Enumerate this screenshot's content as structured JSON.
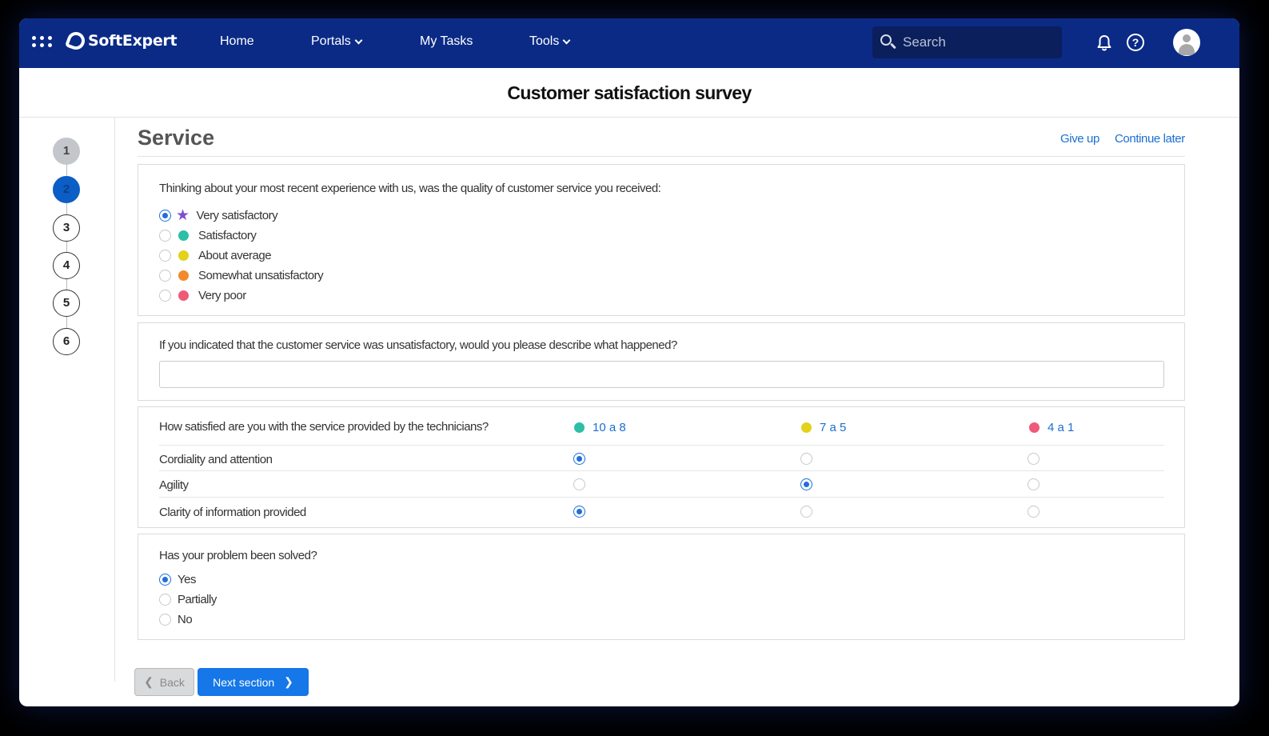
{
  "nav": {
    "brand": "SoftExpert",
    "items": [
      {
        "label": "Home"
      },
      {
        "label": "Portals"
      },
      {
        "label": "My Tasks"
      },
      {
        "label": "Tools"
      }
    ],
    "search_placeholder": "Search"
  },
  "page": {
    "title": "Customer satisfaction survey",
    "section_title": "Service",
    "give_up": "Give up",
    "continue_later": "Continue later"
  },
  "steps": [
    {
      "label": "1",
      "state": "done"
    },
    {
      "label": "2",
      "state": "active"
    },
    {
      "label": "3",
      "state": "pending"
    },
    {
      "label": "4",
      "state": "pending"
    },
    {
      "label": "5",
      "state": "pending"
    },
    {
      "label": "6",
      "state": "pending"
    }
  ],
  "q1": {
    "text": "Thinking about your most recent experience with us, was the quality of customer service you received:",
    "options": [
      {
        "label": "Very satisfactory",
        "marker": "star-icon",
        "color": "#7b4fd3",
        "selected": true
      },
      {
        "label": "Satisfactory",
        "marker": "dot",
        "color": "#2dbfa6",
        "selected": false
      },
      {
        "label": "About average",
        "marker": "dot",
        "color": "#e3d11a",
        "selected": false
      },
      {
        "label": "Somewhat unsatisfactory",
        "marker": "dot",
        "color": "#f28a2a",
        "selected": false
      },
      {
        "label": "Very poor",
        "marker": "dot",
        "color": "#ee5a78",
        "selected": false
      }
    ]
  },
  "q2": {
    "text": "If you indicated that the customer service was unsatisfactory, would you please describe what happened?",
    "value": ""
  },
  "q3": {
    "text": "How satisfied are you with the service provided by the technicians?",
    "columns": [
      {
        "label": "10 a 8",
        "color": "#2dbfa6"
      },
      {
        "label": "7 a 5",
        "color": "#e3d11a"
      },
      {
        "label": "4 a 1",
        "color": "#ee5a78"
      }
    ],
    "rows": [
      {
        "label": "Cordiality and attention",
        "selected": 0
      },
      {
        "label": "Agility",
        "selected": 1
      },
      {
        "label": "Clarity of information provided",
        "selected": 0
      }
    ]
  },
  "q4": {
    "text": "Has your problem been solved?",
    "options": [
      {
        "label": "Yes",
        "selected": true
      },
      {
        "label": "Partially",
        "selected": false
      },
      {
        "label": "No",
        "selected": false
      }
    ]
  },
  "buttons": {
    "back": "Back",
    "next": "Next section"
  },
  "colors": {
    "topbar": "#0a2a86",
    "accent": "#1577e8",
    "link": "#1a6fd1"
  }
}
